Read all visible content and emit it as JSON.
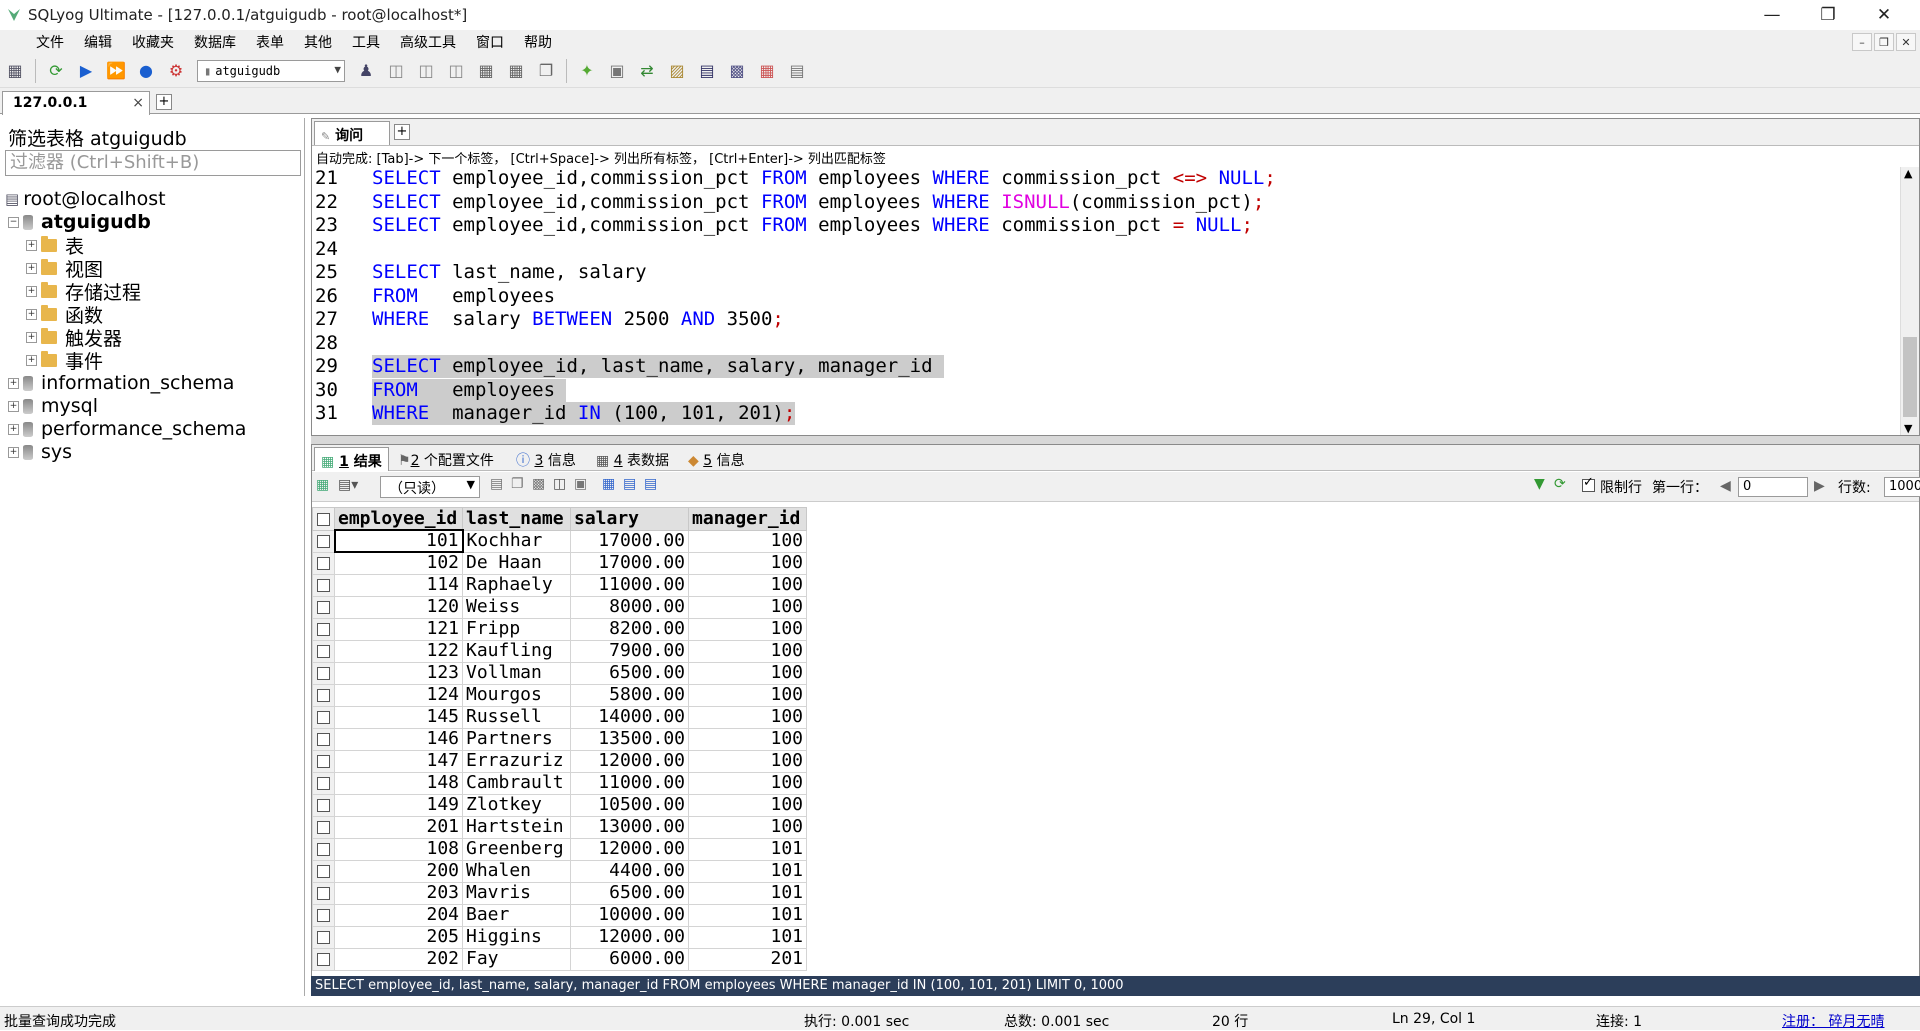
{
  "window": {
    "title": "SQLyog Ultimate - [127.0.0.1/atguigudb - root@localhost*]"
  },
  "menu": [
    "文件",
    "编辑",
    "收藏夹",
    "数据库",
    "表单",
    "其他",
    "工具",
    "高级工具",
    "窗口",
    "帮助"
  ],
  "toolbar": {
    "database": "atguigudb"
  },
  "connection_tab": {
    "label": "127.0.0.1"
  },
  "sidebar": {
    "filter_title": "筛选表格 atguigudb",
    "filter_placeholder": "过滤器 (Ctrl+Shift+B)",
    "root": "root@localhost",
    "db": "atguigudb",
    "children": [
      "表",
      "视图",
      "存储过程",
      "函数",
      "触发器",
      "事件"
    ],
    "other_dbs": [
      "information_schema",
      "mysql",
      "performance_schema",
      "sys"
    ]
  },
  "editor": {
    "tab": "询问",
    "hint": "自动完成: [Tab]-> 下一个标签， [Ctrl+Space]-> 列出所有标签， [Ctrl+Enter]-> 列出匹配标签",
    "lines": [
      {
        "n": "21",
        "tokens": [
          [
            "kw",
            "SELECT"
          ],
          [
            "t",
            " employee_id,commission_pct "
          ],
          [
            "kw",
            "FROM"
          ],
          [
            "t",
            " employees "
          ],
          [
            "kw",
            "WHERE"
          ],
          [
            "t",
            " commission_pct "
          ],
          [
            "op",
            "<=>"
          ],
          [
            "t",
            " "
          ],
          [
            "kw",
            "NULL"
          ],
          [
            "op",
            ";"
          ]
        ]
      },
      {
        "n": "22",
        "tokens": [
          [
            "kw",
            "SELECT"
          ],
          [
            "t",
            " employee_id,commission_pct "
          ],
          [
            "kw",
            "FROM"
          ],
          [
            "t",
            " employees "
          ],
          [
            "kw",
            "WHERE"
          ],
          [
            "t",
            " "
          ],
          [
            "fn",
            "ISNULL"
          ],
          [
            "t",
            "(commission_pct)"
          ],
          [
            "op",
            ";"
          ]
        ]
      },
      {
        "n": "23",
        "tokens": [
          [
            "kw",
            "SELECT"
          ],
          [
            "t",
            " employee_id,commission_pct "
          ],
          [
            "kw",
            "FROM"
          ],
          [
            "t",
            " employees "
          ],
          [
            "kw",
            "WHERE"
          ],
          [
            "t",
            " commission_pct "
          ],
          [
            "op",
            "="
          ],
          [
            "t",
            " "
          ],
          [
            "kw",
            "NULL"
          ],
          [
            "op",
            ";"
          ]
        ]
      },
      {
        "n": "24",
        "tokens": []
      },
      {
        "n": "25",
        "tokens": [
          [
            "kw",
            "SELECT"
          ],
          [
            "t",
            " last_name, salary"
          ]
        ]
      },
      {
        "n": "26",
        "tokens": [
          [
            "kw",
            "FROM"
          ],
          [
            "t",
            "   employees"
          ]
        ]
      },
      {
        "n": "27",
        "tokens": [
          [
            "kw",
            "WHERE"
          ],
          [
            "t",
            "  salary "
          ],
          [
            "kw",
            "BETWEEN"
          ],
          [
            "t",
            " 2500 "
          ],
          [
            "kw",
            "AND"
          ],
          [
            "t",
            " 3500"
          ],
          [
            "op",
            ";"
          ]
        ]
      },
      {
        "n": "28",
        "tokens": []
      },
      {
        "n": "29",
        "sel": true,
        "tokens": [
          [
            "kw",
            "SELECT"
          ],
          [
            "t",
            " employee_id, last_name, salary, manager_id "
          ]
        ]
      },
      {
        "n": "30",
        "sel": true,
        "tokens": [
          [
            "kw",
            "FROM"
          ],
          [
            "t",
            "   employees "
          ]
        ]
      },
      {
        "n": "31",
        "sel": true,
        "tokens": [
          [
            "kw",
            "WHERE"
          ],
          [
            "t",
            "  manager_id "
          ],
          [
            "kw",
            "IN"
          ],
          [
            "t",
            " (100, 101, 201)"
          ],
          [
            "op",
            ";"
          ]
        ]
      }
    ]
  },
  "results_tabs": [
    {
      "num": "1",
      "label": " 结果"
    },
    {
      "num": "2",
      "label": " 个配置文件"
    },
    {
      "num": "3",
      "label": " 信息"
    },
    {
      "num": "4",
      "label": " 表数据"
    },
    {
      "num": "5",
      "label": " 信息"
    }
  ],
  "results_toolbar": {
    "mode": "（只读）",
    "limit_label": "限制行",
    "first_row_label": "第一行：",
    "first_row": "0",
    "rows_label": "行数:",
    "rows": "1000"
  },
  "table": {
    "columns": [
      "employee_id",
      "last_name",
      "salary",
      "manager_id"
    ],
    "rows": [
      [
        "101",
        "Kochhar",
        "17000.00",
        "100"
      ],
      [
        "102",
        "De Haan",
        "17000.00",
        "100"
      ],
      [
        "114",
        "Raphaely",
        "11000.00",
        "100"
      ],
      [
        "120",
        "Weiss",
        "8000.00",
        "100"
      ],
      [
        "121",
        "Fripp",
        "8200.00",
        "100"
      ],
      [
        "122",
        "Kaufling",
        "7900.00",
        "100"
      ],
      [
        "123",
        "Vollman",
        "6500.00",
        "100"
      ],
      [
        "124",
        "Mourgos",
        "5800.00",
        "100"
      ],
      [
        "145",
        "Russell",
        "14000.00",
        "100"
      ],
      [
        "146",
        "Partners",
        "13500.00",
        "100"
      ],
      [
        "147",
        "Errazuriz",
        "12000.00",
        "100"
      ],
      [
        "148",
        "Cambrault",
        "11000.00",
        "100"
      ],
      [
        "149",
        "Zlotkey",
        "10500.00",
        "100"
      ],
      [
        "201",
        "Hartstein",
        "13000.00",
        "100"
      ],
      [
        "108",
        "Greenberg",
        "12000.00",
        "101"
      ],
      [
        "200",
        "Whalen",
        "4400.00",
        "101"
      ],
      [
        "203",
        "Mavris",
        "6500.00",
        "101"
      ],
      [
        "204",
        "Baer",
        "10000.00",
        "101"
      ],
      [
        "205",
        "Higgins",
        "12000.00",
        "101"
      ],
      [
        "202",
        "Fay",
        "6000.00",
        "201"
      ]
    ]
  },
  "sql_status": "SELECT employee_id, last_name, salary, manager_id FROM employees WHERE manager_id IN (100, 101, 201) LIMIT 0, 1000",
  "status": {
    "left": "批量查询成功完成",
    "exec": "执行: 0.001 sec",
    "total": "总数: 0.001 sec",
    "rows": "20 行",
    "pos": "Ln 29, Col 1",
    "conn": "连接: 1",
    "register": "注册： 碎月无晴"
  }
}
